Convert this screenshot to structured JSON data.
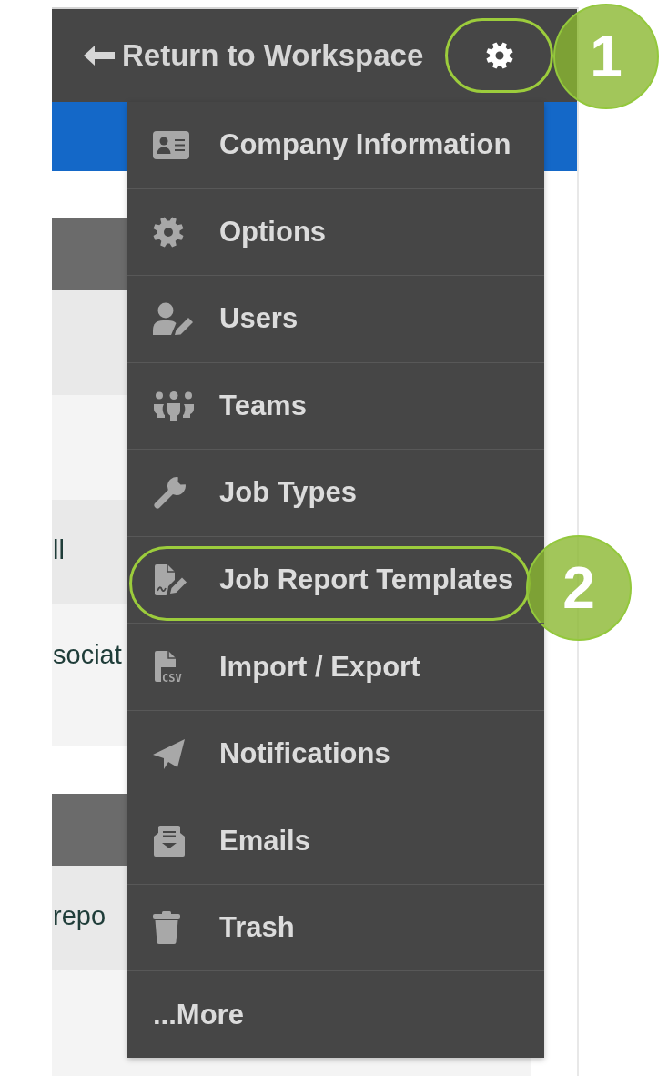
{
  "header": {
    "back_link": "Return to Workspace",
    "settings_button": {
      "expanded": true,
      "callout": "1"
    }
  },
  "settings_menu": {
    "items": [
      {
        "label": "Company Information",
        "kind": "icon"
      },
      {
        "label": "Options",
        "kind": "icon"
      },
      {
        "label": "Users",
        "kind": "icon"
      },
      {
        "label": "Teams",
        "kind": "icon"
      },
      {
        "label": "Job Types",
        "kind": "icon"
      },
      {
        "label": "Job Report Templates",
        "kind": "icon",
        "callout": "2"
      },
      {
        "label": "Import / Export",
        "kind": "icon",
        "icon_label": "CSV"
      },
      {
        "label": "Notifications",
        "kind": "icon"
      },
      {
        "label": "Emails",
        "kind": "icon"
      },
      {
        "label": "Trash",
        "kind": "icon"
      },
      {
        "label": "...More",
        "kind": "text"
      }
    ]
  },
  "background_tables": [
    {
      "rows": [
        {},
        {},
        {
          "column_1": "ll"
        },
        {
          "column_1": "sociat"
        }
      ]
    },
    {
      "rows": [
        {
          "column_1": "repo"
        },
        {}
      ]
    }
  ]
}
